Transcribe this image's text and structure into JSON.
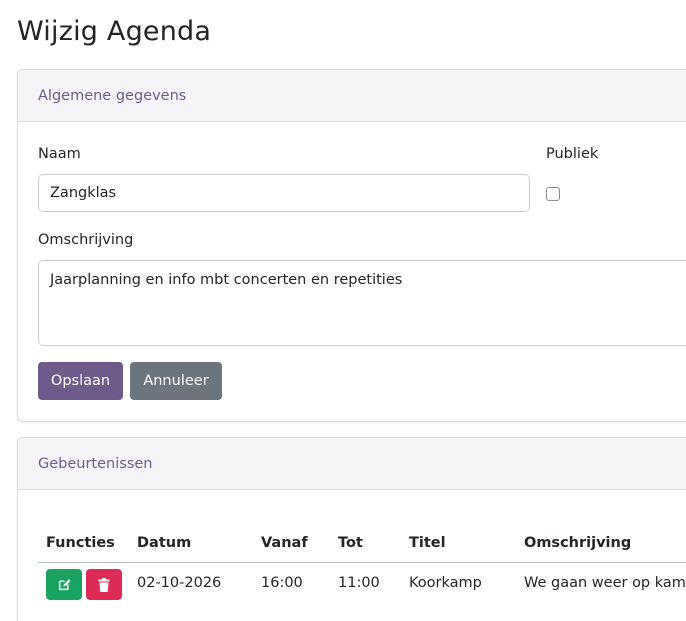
{
  "page": {
    "title": "Wijzig Agenda"
  },
  "general": {
    "header": "Algemene gegevens",
    "name_label": "Naam",
    "name_value": "Zangklas",
    "public_label": "Publiek",
    "public_checked": false,
    "description_label": "Omschrijving",
    "description_value": "Jaarplanning en info mbt concerten en repetities",
    "save_label": "Opslaan",
    "cancel_label": "Annuleer"
  },
  "events": {
    "header": "Gebeurtenissen",
    "columns": [
      "Functies",
      "Datum",
      "Vanaf",
      "Tot",
      "Titel",
      "Omschrijving"
    ],
    "rows": [
      {
        "date": "02-10-2026",
        "from": "16:00",
        "to": "11:00",
        "title": "Koorkamp",
        "description": "We gaan weer op kamp"
      }
    ],
    "row_actions": [
      "edit-icon",
      "trash-icon"
    ]
  },
  "colors": {
    "primary": "#6f5b8b",
    "secondary": "#6c757d",
    "success": "#1aa35f",
    "danger": "#dc2c56"
  }
}
